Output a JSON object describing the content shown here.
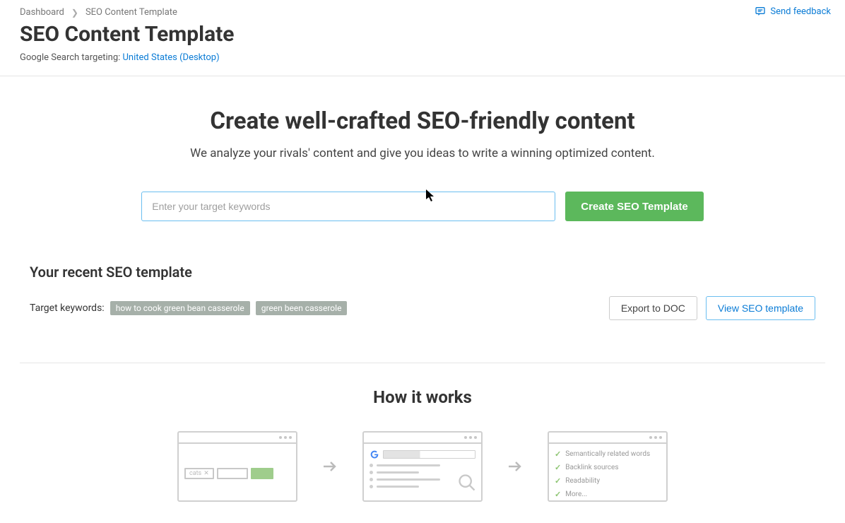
{
  "breadcrumb": {
    "root": "Dashboard",
    "current": "SEO Content Template"
  },
  "page_title": "SEO Content Template",
  "targeting": {
    "label": "Google Search targeting: ",
    "value": "United States (Desktop)"
  },
  "feedback_label": "Send feedback",
  "hero": {
    "title": "Create well-crafted SEO-friendly content",
    "subtitle": "We analyze your rivals' content and give you ideas to write a winning optimized content."
  },
  "search": {
    "placeholder": "Enter your target keywords",
    "button": "Create SEO Template"
  },
  "recent": {
    "title": "Your recent SEO template",
    "kw_label": "Target keywords:",
    "keywords": [
      "how to cook green bean casserole",
      "green been casserole"
    ],
    "export_btn": "Export to DOC",
    "view_btn": "View SEO template"
  },
  "how": {
    "title": "How it works",
    "step1_tag": "cats",
    "step3_items": [
      "Semantically related words",
      "Backlink sources",
      "Readability",
      "More..."
    ]
  }
}
